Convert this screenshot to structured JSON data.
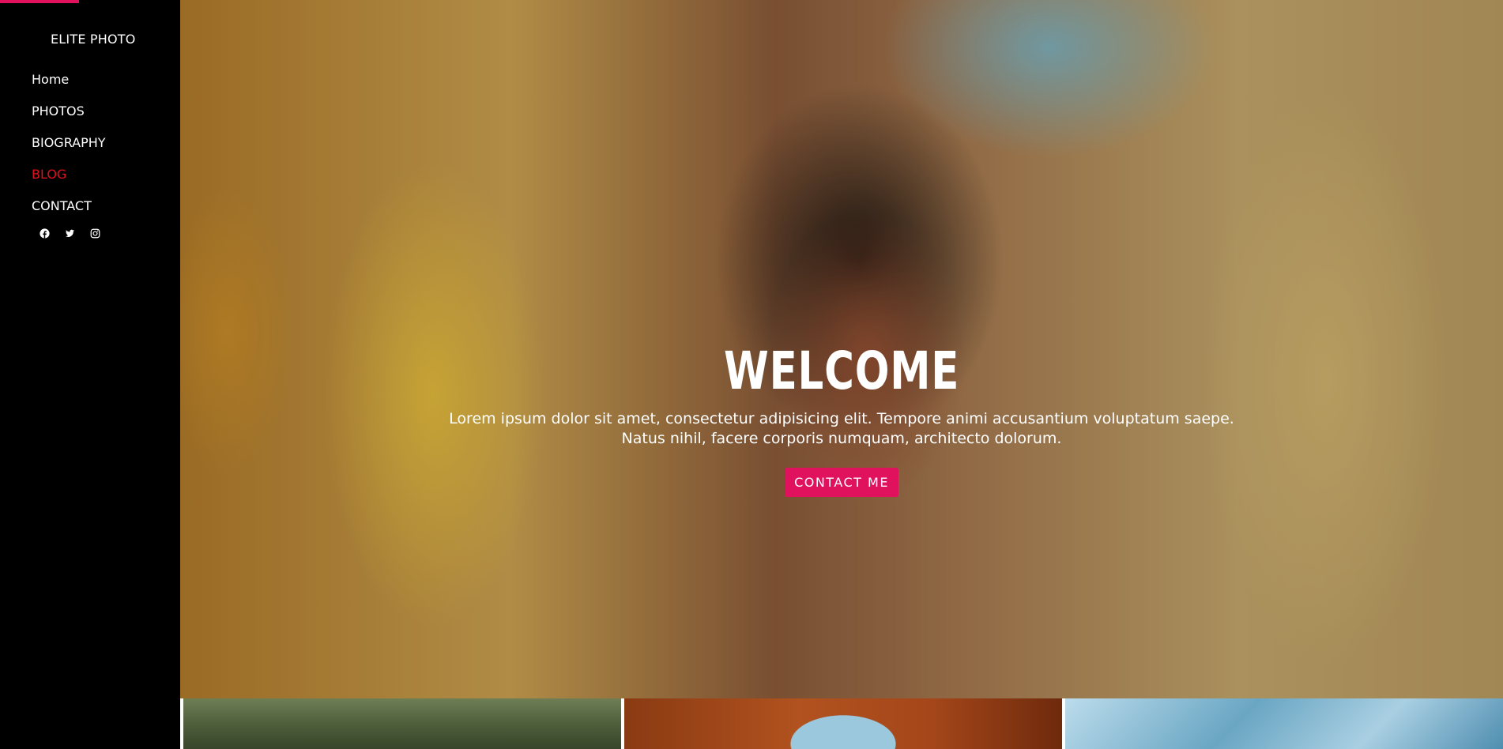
{
  "sidebar": {
    "brand": "ELITE PHOTO",
    "accent_color": "#e0125e",
    "active_color": "#e0101e",
    "nav": [
      {
        "label": "Home",
        "active": false
      },
      {
        "label": "PHOTOS",
        "active": false
      },
      {
        "label": "BIOGRAPHY",
        "active": false
      },
      {
        "label": "BLOG",
        "active": true
      },
      {
        "label": "CONTACT",
        "active": false
      }
    ],
    "social": [
      "facebook-icon",
      "twitter-icon",
      "instagram-icon"
    ]
  },
  "hero": {
    "title": "WELCOME",
    "text_line_1": "Lorem ipsum dolor sit amet, consectetur adipisicing elit. Tempore animi accusantium voluptatum saepe.",
    "text_line_2": "Natus nihil, facere corporis numquam, architecto dolorum.",
    "button_label": "CONTACT ME",
    "button_color": "#e0125e"
  },
  "gallery": {
    "thumbnails": [
      "plants-thumbnail",
      "canyon-thumbnail",
      "ice-thumbnail"
    ]
  }
}
